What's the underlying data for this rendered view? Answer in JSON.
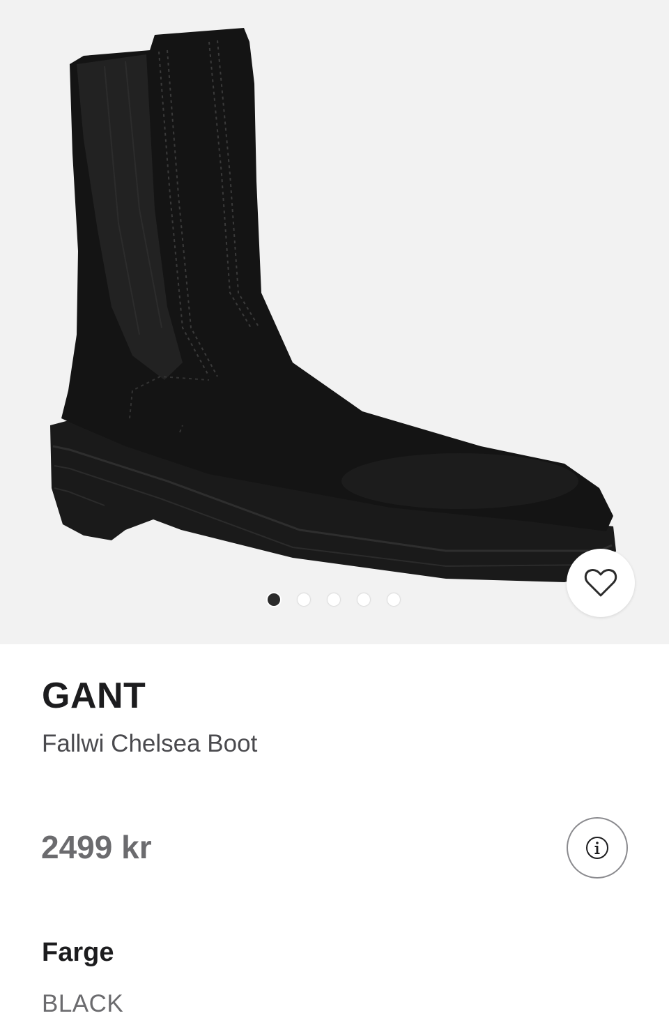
{
  "product": {
    "brand": "GANT",
    "name": "Fallwi Chelsea Boot",
    "price": "2499 kr"
  },
  "gallery": {
    "image_count": 5,
    "active_index": 0,
    "icons": {
      "favorite": "heart-outline-icon",
      "info": "info-circle-icon"
    }
  },
  "color": {
    "heading": "Farge",
    "value": "BLACK"
  },
  "colors": {
    "background": "#ffffff",
    "image_background": "#f2f2f2",
    "text_primary": "#1c1c1e",
    "text_secondary": "#6b6b6e"
  }
}
